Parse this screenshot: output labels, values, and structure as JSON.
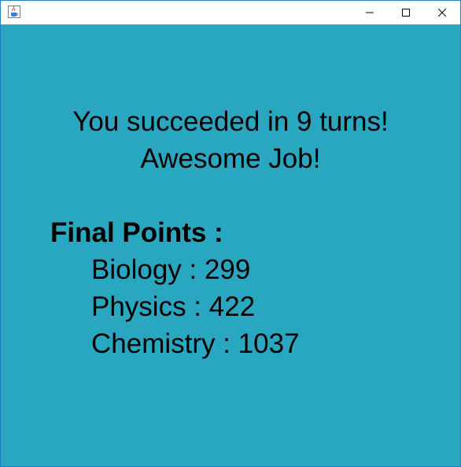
{
  "window": {
    "icon": "java-cup-icon",
    "controls": [
      "minimize-icon",
      "maximize-icon",
      "close-icon"
    ]
  },
  "message": {
    "line1": "You succeeded in 9 turns!",
    "line2": "Awesome Job!"
  },
  "final_points": {
    "heading": "Final Points :",
    "scores": [
      "Biology : 299",
      "Physics : 422",
      "Chemistry : 1037"
    ]
  },
  "colors": {
    "background": "#2aa7c0",
    "text": "#000000",
    "window_border": "#1e7fc4"
  }
}
